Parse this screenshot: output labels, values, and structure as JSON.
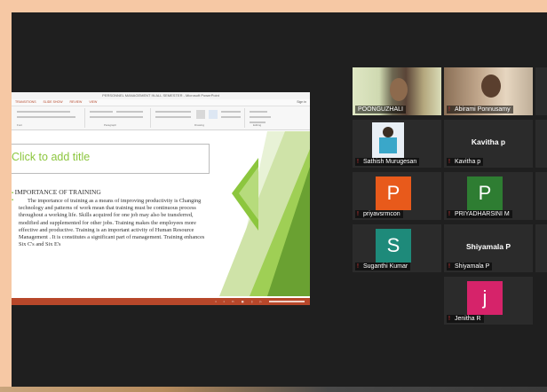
{
  "ppt": {
    "window_title": "PERSONNEL MANAGEMENT IN ALL SEMESTER - Microsoft PowerPoint",
    "tabs": [
      "TRANSITIONS",
      "SLIDE SHOW",
      "REVIEW",
      "VIEW"
    ],
    "sign_in": "Sign in",
    "groups": [
      "Font",
      "Paragraph",
      "Drawing",
      "Editing"
    ],
    "slide": {
      "title_placeholder": "Click to add title",
      "bullet_title": "IMPORTANCE OF TRAINING",
      "body": "The importance of training as a means of improving productivity is      Changing technology and patterns of work mean that training must be continuous process throughout a working life.  Skills acquired for one job may also be transferred, modified and supplemented for other jobs.  Training makes the employees more effective and productive.  Training is an important activity of Human Resource Management .  It is constitutes a significant part of management.  Training enhances Six C's and Six E's"
    },
    "colors": {
      "accent": "#8cc63e",
      "status_bar": "#b7472a"
    }
  },
  "participants": [
    {
      "name": "POONGUZHALI",
      "type": "video",
      "active": true
    },
    {
      "name": "Abirami Ponnusamy",
      "type": "video"
    },
    {
      "name": "Sathish Murugesan",
      "type": "photo"
    },
    {
      "name": "Kavitha p",
      "type": "name",
      "display": "Kavitha p"
    },
    {
      "name": "priyavsrmcon",
      "type": "avatar",
      "letter": "P",
      "color": "#e85a1b"
    },
    {
      "name": "PRIYADHARSINI M",
      "type": "avatar",
      "letter": "P",
      "color": "#2e7d32"
    },
    {
      "name": "Suganthi Kumar",
      "type": "avatar",
      "letter": "S",
      "color": "#1e8a7a"
    },
    {
      "name": "Shiyamala P",
      "type": "name",
      "display": "Shiyamala P"
    },
    {
      "name": "Jenitha R",
      "type": "avatar",
      "letter": "j",
      "color": "#d6236a"
    }
  ]
}
